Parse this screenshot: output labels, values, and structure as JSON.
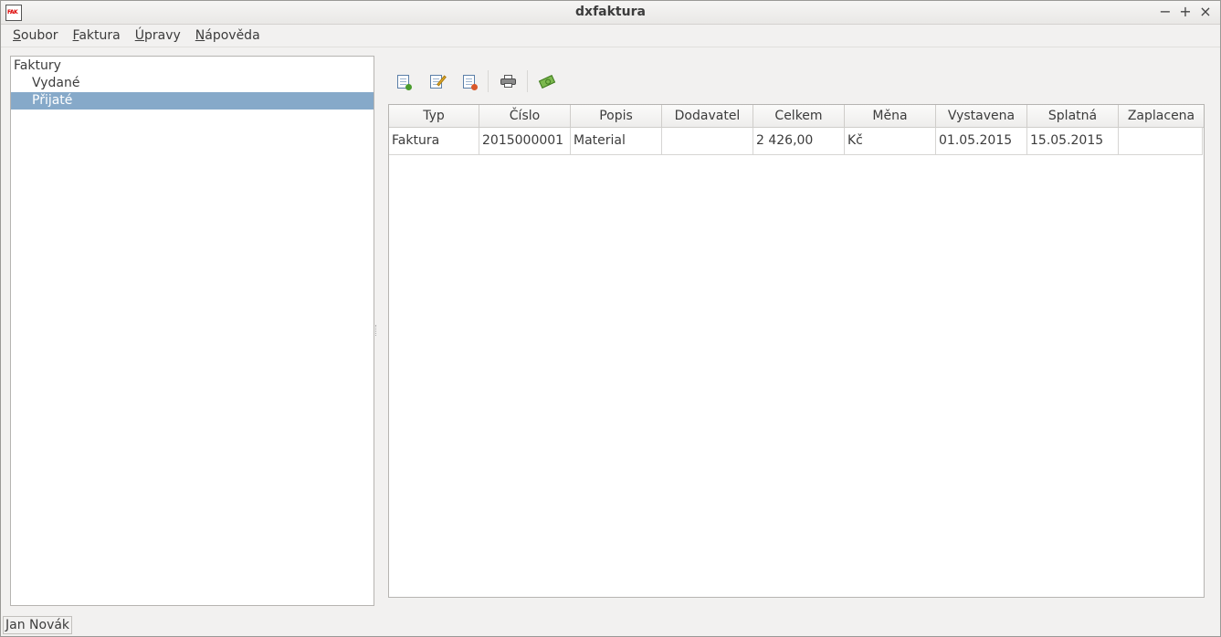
{
  "window": {
    "title": "dxfaktura",
    "icon_text": "FAK",
    "controls": {
      "minimize": "−",
      "maximize": "+",
      "close": "×"
    }
  },
  "menu": [
    {
      "label": "Soubor",
      "mnemonic": "S",
      "rest": "oubor"
    },
    {
      "label": "Faktura",
      "mnemonic": "F",
      "rest": "aktura"
    },
    {
      "label": "Úpravy",
      "mnemonic": "Ú",
      "rest": "pravy"
    },
    {
      "label": "Nápověda",
      "mnemonic": "N",
      "rest": "ápověda"
    }
  ],
  "tree": {
    "root": "Faktury",
    "children": [
      "Vydané",
      "Přijaté"
    ],
    "selected": "Přijaté"
  },
  "toolbar": {
    "buttons": [
      "new-document-icon",
      "edit-document-icon",
      "delete-document-icon",
      "print-icon",
      "payment-icon"
    ]
  },
  "table": {
    "columns": [
      "Typ",
      "Číslo",
      "Popis",
      "Dodavatel",
      "Celkem",
      "Měna",
      "Vystavena",
      "Splatná",
      "Zaplacena"
    ],
    "rows": [
      [
        "Faktura",
        "2015000001",
        "Material",
        "",
        "2 426,00",
        "Kč",
        "01.05.2015",
        "15.05.2015",
        ""
      ]
    ]
  },
  "status": {
    "user": "Jan Novák"
  },
  "colors": {
    "selection": "#86a9c9",
    "background": "#f2f1f0"
  }
}
